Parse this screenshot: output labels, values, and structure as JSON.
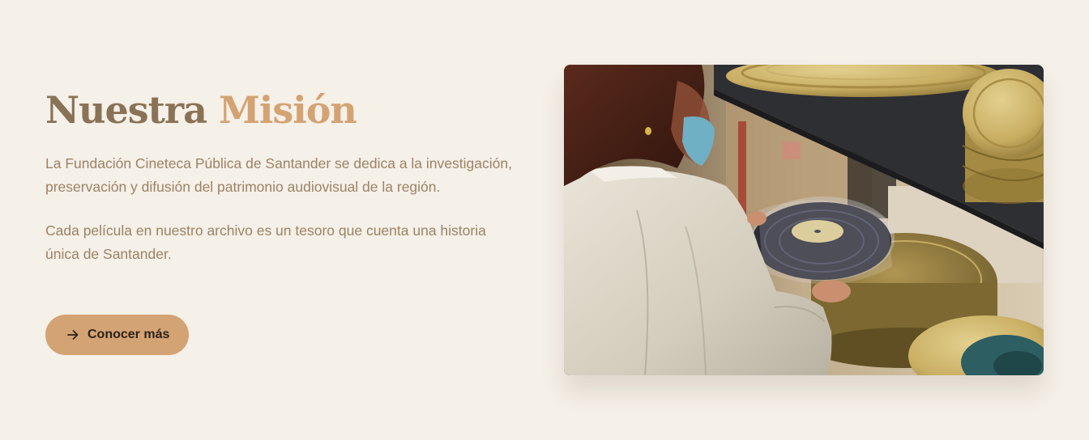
{
  "mission": {
    "title_primary": "Nuestra",
    "title_accent": "Misión",
    "paragraph_1": "La Fundación Cineteca Pública de Santander se dedica a la investigación, preservación y difusión del patrimonio audiovisual de la región.",
    "paragraph_2": "Cada película en nuestro archivo es un tesoro que cuenta una historia única de Santander.",
    "cta_label": "Conocer más",
    "cta_icon": "arrow-right-icon"
  },
  "colors": {
    "background": "#f5f0e8",
    "title": "#8a7256",
    "accent": "#d4a373",
    "body_text": "#9c8366",
    "button_text": "#2b2218"
  }
}
